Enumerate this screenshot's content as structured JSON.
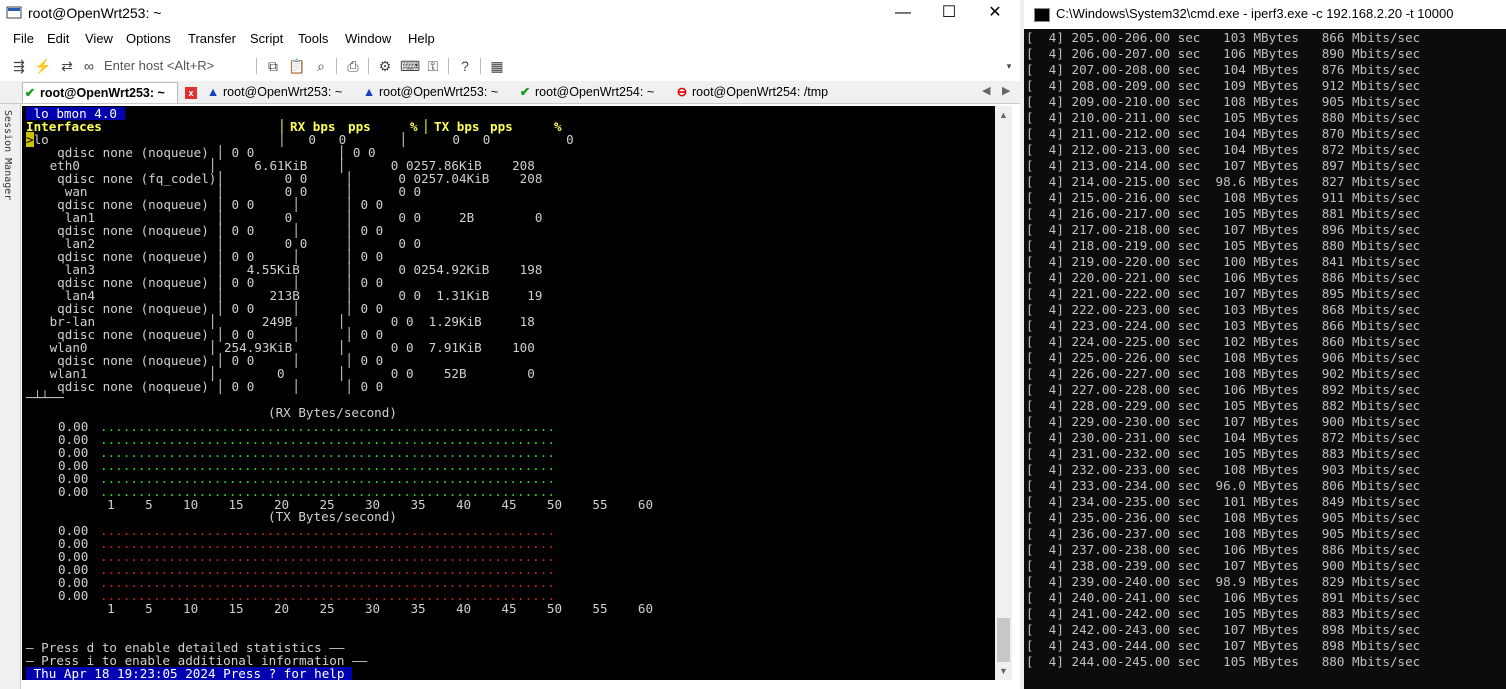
{
  "crt": {
    "title": "root@OpenWrt253: ~",
    "window_buttons": [
      "—",
      "☐",
      "✕"
    ],
    "menu": [
      "File",
      "Edit",
      "View",
      "Options",
      "Transfer",
      "Script",
      "Tools",
      "Window",
      "Help"
    ],
    "host_placeholder": "Enter host <Alt+R>",
    "tabs": [
      {
        "label": "root@OpenWrt253: ~",
        "status": "connected",
        "active": true
      },
      {
        "label": "root@OpenWrt253: ~",
        "status": "warning",
        "active": false
      },
      {
        "label": "root@OpenWrt253: ~",
        "status": "warning",
        "active": false
      },
      {
        "label": "root@OpenWrt254: ~",
        "status": "connected",
        "active": false
      },
      {
        "label": "root@OpenWrt254: /tmp",
        "status": "disconnected",
        "active": false
      }
    ],
    "sidebar_label": "Session Manager"
  },
  "bmon": {
    "title": " lo bmon 4.0 ",
    "header": {
      "interfaces": "Interfaces",
      "rx": "RX bps",
      "pps": "pps",
      "pct": "%",
      "tx": "TX bps",
      "tx_pps": "pps",
      "tx_pct": "%"
    },
    "rows": [
      "│   0   0       │      0   0          0",
      "  qdisc none (noqueue) │ 0 0           │ 0 0",
      " eth0                 │     6.61KiB    │      0 0257.86KiB    208",
      "  qdisc none (fq_codel)│        0 0     │      0 0257.04KiB    208",
      "   wan                 │        0 0     │      0 0",
      "  qdisc none (noqueue) │ 0 0     │      │ 0 0",
      "   lan1                │        0       │      0 0     2B        0",
      "  qdisc none (noqueue) │ 0 0     │      │ 0 0",
      "   lan2                │        0 0     │      0 0",
      "  qdisc none (noqueue) │ 0 0     │      │ 0 0",
      "   lan3                │   4.55KiB      │      0 0254.92KiB    198",
      "  qdisc none (noqueue) │ 0 0     │      │ 0 0",
      "   lan4                │      213B      │      0 0  1.31KiB     19",
      "  qdisc none (noqueue) │ 0 0     │      │ 0 0",
      " br-lan               │      249B      │      0 0  1.29KiB     18",
      "  qdisc none (noqueue) │ 0 0     │      │ 0 0",
      " wlan0                │ 254.93KiB      │      0 0  7.91KiB    100",
      "  qdisc none (noqueue) │ 0 0     │      │ 0 0",
      " wlan1                │        0       │      0 0    52B        0",
      "  qdisc none (noqueue) │ 0 0     │      │ 0 0"
    ],
    "first_iface": "lo",
    "rx_graph_title": "(RX Bytes/second)",
    "tx_graph_title": "(TX Bytes/second)",
    "graph_ylabels": [
      "0.00",
      "0.00",
      "0.00",
      "0.00",
      "0.00",
      "0.00"
    ],
    "graph_xlabels": "  1    5    10    15    20    25    30    35    40    45    50    55    60",
    "footer1": "— Press d to enable detailed statistics ——",
    "footer2": "— Press i to enable additional information ——",
    "status": " Thu Apr 18 19:23:05 2024 Press ? for help "
  },
  "cmd": {
    "title": "C:\\Windows\\System32\\cmd.exe - iperf3.exe  -c 192.168.2.20 -t 10000",
    "lines": [
      "[  4] 205.00-206.00 sec   103 MBytes   866 Mbits/sec",
      "[  4] 206.00-207.00 sec   106 MBytes   890 Mbits/sec",
      "[  4] 207.00-208.00 sec   104 MBytes   876 Mbits/sec",
      "[  4] 208.00-209.00 sec   109 MBytes   912 Mbits/sec",
      "[  4] 209.00-210.00 sec   108 MBytes   905 Mbits/sec",
      "[  4] 210.00-211.00 sec   105 MBytes   880 Mbits/sec",
      "[  4] 211.00-212.00 sec   104 MBytes   870 Mbits/sec",
      "[  4] 212.00-213.00 sec   104 MBytes   872 Mbits/sec",
      "[  4] 213.00-214.00 sec   107 MBytes   897 Mbits/sec",
      "[  4] 214.00-215.00 sec  98.6 MBytes   827 Mbits/sec",
      "[  4] 215.00-216.00 sec   108 MBytes   911 Mbits/sec",
      "[  4] 216.00-217.00 sec   105 MBytes   881 Mbits/sec",
      "[  4] 217.00-218.00 sec   107 MBytes   896 Mbits/sec",
      "[  4] 218.00-219.00 sec   105 MBytes   880 Mbits/sec",
      "[  4] 219.00-220.00 sec   100 MBytes   841 Mbits/sec",
      "[  4] 220.00-221.00 sec   106 MBytes   886 Mbits/sec",
      "[  4] 221.00-222.00 sec   107 MBytes   895 Mbits/sec",
      "[  4] 222.00-223.00 sec   103 MBytes   868 Mbits/sec",
      "[  4] 223.00-224.00 sec   103 MBytes   866 Mbits/sec",
      "[  4] 224.00-225.00 sec   102 MBytes   860 Mbits/sec",
      "[  4] 225.00-226.00 sec   108 MBytes   906 Mbits/sec",
      "[  4] 226.00-227.00 sec   108 MBytes   902 Mbits/sec",
      "[  4] 227.00-228.00 sec   106 MBytes   892 Mbits/sec",
      "[  4] 228.00-229.00 sec   105 MBytes   882 Mbits/sec",
      "[  4] 229.00-230.00 sec   107 MBytes   900 Mbits/sec",
      "[  4] 230.00-231.00 sec   104 MBytes   872 Mbits/sec",
      "[  4] 231.00-232.00 sec   105 MBytes   883 Mbits/sec",
      "[  4] 232.00-233.00 sec   108 MBytes   903 Mbits/sec",
      "[  4] 233.00-234.00 sec  96.0 MBytes   806 Mbits/sec",
      "[  4] 234.00-235.00 sec   101 MBytes   849 Mbits/sec",
      "[  4] 235.00-236.00 sec   108 MBytes   905 Mbits/sec",
      "[  4] 236.00-237.00 sec   108 MBytes   905 Mbits/sec",
      "[  4] 237.00-238.00 sec   106 MBytes   886 Mbits/sec",
      "[  4] 238.00-239.00 sec   107 MBytes   900 Mbits/sec",
      "[  4] 239.00-240.00 sec  98.9 MBytes   829 Mbits/sec",
      "[  4] 240.00-241.00 sec   106 MBytes   891 Mbits/sec",
      "[  4] 241.00-242.00 sec   105 MBytes   883 Mbits/sec",
      "[  4] 242.00-243.00 sec   107 MBytes   898 Mbits/sec",
      "[  4] 243.00-244.00 sec   107 MBytes   898 Mbits/sec",
      "[  4] 244.00-245.00 sec   105 MBytes   880 Mbits/sec"
    ]
  },
  "colors": {
    "terminal_bg": "#000000",
    "bmon_header": "#ffff55",
    "bmon_title_bar": "#0000b0",
    "rx_graph_dots": "#22dd22",
    "tx_graph_dots": "#cc2222",
    "cmd_bg": "#0c0c0c"
  }
}
